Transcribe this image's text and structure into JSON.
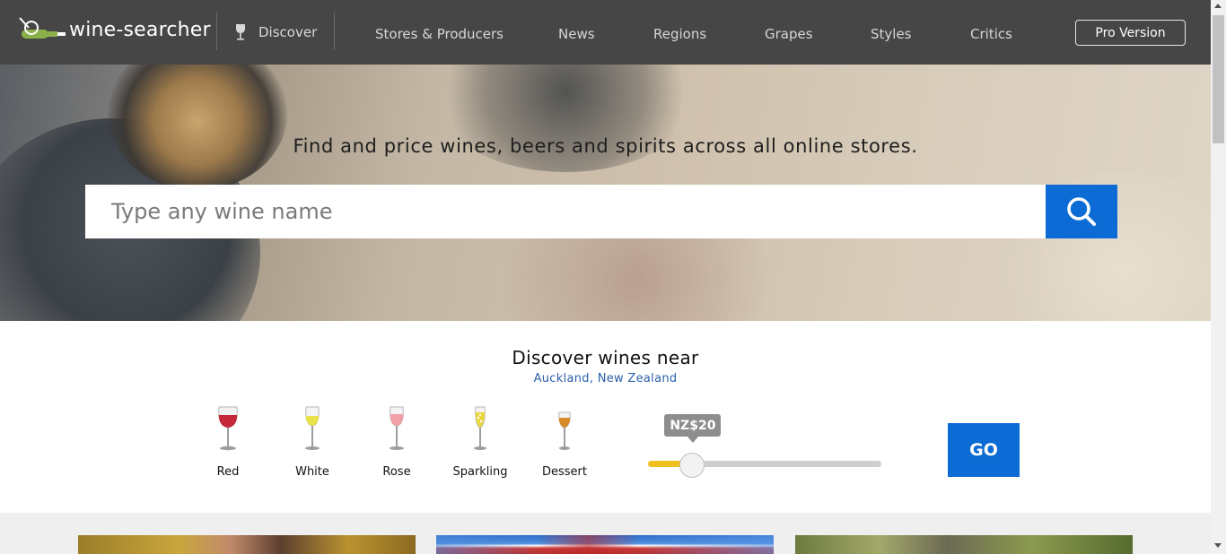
{
  "header": {
    "logo_text": "wine-searcher",
    "discover_label": "Discover",
    "nav": [
      {
        "label": "Stores & Producers"
      },
      {
        "label": "News"
      },
      {
        "label": "Regions"
      },
      {
        "label": "Grapes"
      },
      {
        "label": "Styles"
      },
      {
        "label": "Critics"
      }
    ],
    "pro_label": "Pro Version"
  },
  "hero": {
    "tagline": "Find and price wines, beers and spirits across all online stores.",
    "search_placeholder": "Type any wine name",
    "search_icon": "search-icon"
  },
  "discover": {
    "title": "Discover wines near",
    "location": "Auckland, New Zealand",
    "wine_types": [
      {
        "label": "Red",
        "icon": "red-wine-glass-icon",
        "color": "#c4283a"
      },
      {
        "label": "White",
        "icon": "white-wine-glass-icon",
        "color": "#e9e34a"
      },
      {
        "label": "Rose",
        "icon": "rose-wine-glass-icon",
        "color": "#f0a0a6"
      },
      {
        "label": "Sparkling",
        "icon": "sparkling-wine-glass-icon",
        "color": "#e9d840"
      },
      {
        "label": "Dessert",
        "icon": "dessert-wine-glass-icon",
        "color": "#d68a2a"
      }
    ],
    "price": {
      "label": "NZ$20",
      "slider_fraction": 0.19
    },
    "go_label": "GO"
  },
  "colors": {
    "header_bg": "#464646",
    "accent_blue": "#0c6bd4",
    "slider_fill": "#f0c020"
  }
}
